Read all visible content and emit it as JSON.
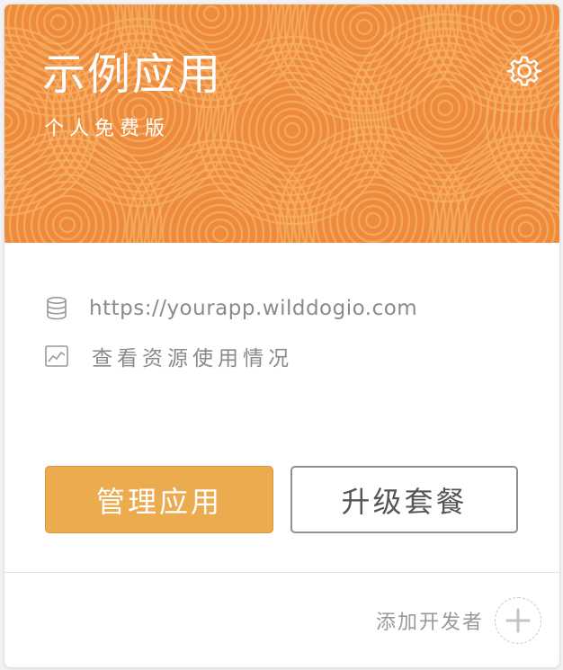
{
  "app": {
    "name": "示例应用",
    "plan": "个人免费版",
    "url": "https://yourapp.wilddogio.com",
    "usage_link": "查看资源使用情况"
  },
  "actions": {
    "manage_label": "管理应用",
    "upgrade_label": "升级套餐",
    "add_developer_label": "添加开发者"
  },
  "icons": {
    "settings": "gear-icon",
    "database": "database-icon",
    "usage": "chart-icon",
    "add": "plus-icon"
  },
  "colors": {
    "header_background": "#ee8a3c",
    "pattern_stroke": "#f6b066",
    "primary_button": "#ecab4f",
    "secondary_button_border": "#8f8f8f",
    "muted_text": "#8a8a8a"
  }
}
